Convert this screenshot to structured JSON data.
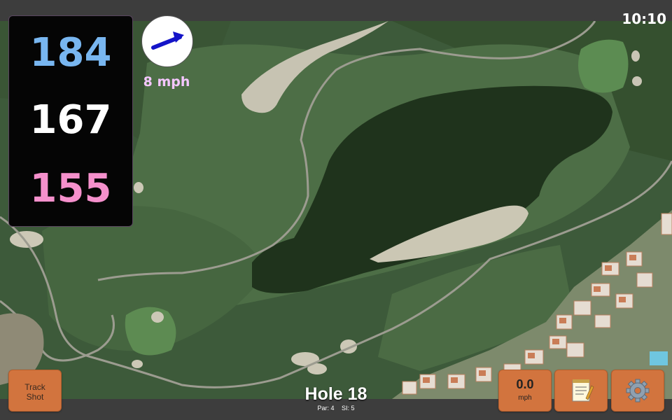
{
  "status_bar": {
    "time": "10:10"
  },
  "distances": {
    "back": "184",
    "middle": "167",
    "front": "155"
  },
  "wind": {
    "speed_label": "8 mph",
    "direction_icon": "arrow-up-right-icon"
  },
  "buttons": {
    "track_shot_label": "Track Shot",
    "speed_value": "0.0",
    "speed_unit": "mph",
    "notes_icon": "notepad-icon",
    "settings_icon": "gear-icon"
  },
  "hole": {
    "title": "Hole 18",
    "par_label": "Par: 4",
    "si_label": "SI: 5"
  },
  "colors": {
    "back_distance": "#78b6f0",
    "middle_distance": "#ffffff",
    "front_distance": "#f590cc",
    "button": "#d2743e",
    "wind_text": "#f4c6ff"
  }
}
